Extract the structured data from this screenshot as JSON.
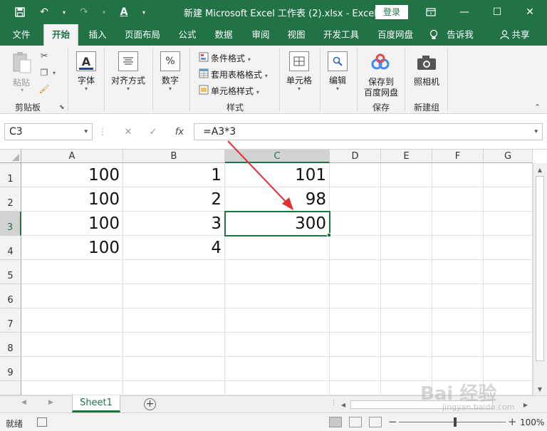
{
  "window": {
    "title": "新建 Microsoft Excel 工作表 (2).xlsx  -  Excel",
    "login_label": "登录"
  },
  "menu": {
    "tabs": [
      "文件",
      "开始",
      "插入",
      "页面布局",
      "公式",
      "数据",
      "审阅",
      "视图",
      "开发工具",
      "百度网盘"
    ],
    "active_tab": "开始",
    "tell_me": "告诉我",
    "share": "共享"
  },
  "ribbon": {
    "clipboard": {
      "paste": "粘贴",
      "group": "剪贴板"
    },
    "font": {
      "label": "字体",
      "icon_letter": "A"
    },
    "alignment": {
      "label": "对齐方式"
    },
    "number": {
      "label": "数字",
      "icon_text": "%"
    },
    "styles": {
      "conditional_formatting": "条件格式",
      "format_as_table": "套用表格格式",
      "cell_styles": "单元格样式",
      "group": "样式"
    },
    "cells": {
      "label": "单元格"
    },
    "editing": {
      "label": "编辑"
    },
    "save": {
      "label_line1": "保存到",
      "label_line2": "百度网盘",
      "group": "保存"
    },
    "camera": {
      "label": "照相机",
      "group": "新建组"
    }
  },
  "formula_bar": {
    "name_box": "C3",
    "formula": "=A3*3",
    "fx_label": "fx"
  },
  "grid": {
    "columns": [
      "A",
      "B",
      "C",
      "D",
      "E",
      "F",
      "G"
    ],
    "selected_column": "C",
    "rows": [
      "1",
      "2",
      "3",
      "4",
      "5",
      "6",
      "7",
      "8",
      "9"
    ],
    "selected_row": "3",
    "cells": {
      "A1": "100",
      "B1": "1",
      "C1": "101",
      "A2": "100",
      "B2": "2",
      "C2": "98",
      "A3": "100",
      "B3": "3",
      "C3": "300",
      "A4": "100",
      "B4": "4"
    },
    "selected_cell": "C3"
  },
  "sheets": {
    "tabs": [
      "Sheet1"
    ],
    "active": "Sheet1"
  },
  "status": {
    "ready": "就绪",
    "zoom": "100%"
  },
  "watermark": {
    "main": "Bai 经验",
    "sub": "jingyan.baidu.com"
  },
  "colors": {
    "excel_green": "#217346",
    "annotation_red": "#e03030"
  }
}
